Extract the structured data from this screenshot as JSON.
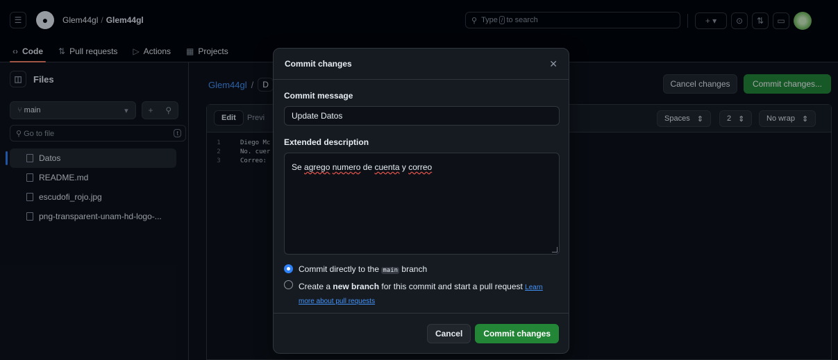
{
  "header": {
    "owner": "Glem44gl",
    "separator": "/",
    "repo": "Glem44gl",
    "search_prefix": "Type",
    "search_key": "/",
    "search_suffix": "to search"
  },
  "tabs": [
    {
      "label": "Code",
      "icon": "code-icon"
    },
    {
      "label": "Pull requests",
      "icon": "pull-request-icon"
    },
    {
      "label": "Actions",
      "icon": "play-icon"
    },
    {
      "label": "Projects",
      "icon": "table-icon"
    }
  ],
  "sidebar": {
    "title": "Files",
    "branch": "main",
    "goto_placeholder": "Go to file",
    "goto_key": "t",
    "files": [
      "Datos",
      "README.md",
      "escudofi_rojo.jpg",
      "png-transparent-unam-hd-logo-..."
    ]
  },
  "main": {
    "breadcrumb_root": "Glem44gl",
    "breadcrumb_sep": "/",
    "path_partial": "D",
    "cancel_label": "Cancel changes",
    "commit_label": "Commit changes...",
    "editor": {
      "edit_tab": "Edit",
      "preview_tab": "Previ",
      "indent_mode": "Spaces",
      "indent_size": "2",
      "wrap_mode": "No wrap",
      "lines": [
        {
          "n": "1",
          "text": "Diego Mc"
        },
        {
          "n": "2",
          "text": "No. cuer"
        },
        {
          "n": "3",
          "text": "Correo:"
        }
      ]
    }
  },
  "modal": {
    "title": "Commit changes",
    "message_label": "Commit message",
    "message_value": "Update Datos",
    "description_label": "Extended description",
    "description_words": [
      "Se",
      "agrego",
      "numero",
      "de",
      "cuenta",
      "y",
      "correo"
    ],
    "option1_prefix": "Commit directly to the",
    "option1_branch": "main",
    "option1_suffix": "branch",
    "option2_prefix": "Create a",
    "option2_bold": "new branch",
    "option2_suffix": "for this commit and start a pull request",
    "option2_link1": "Learn",
    "option2_link2": "more about pull requests",
    "cancel_label": "Cancel",
    "commit_label": "Commit changes"
  }
}
